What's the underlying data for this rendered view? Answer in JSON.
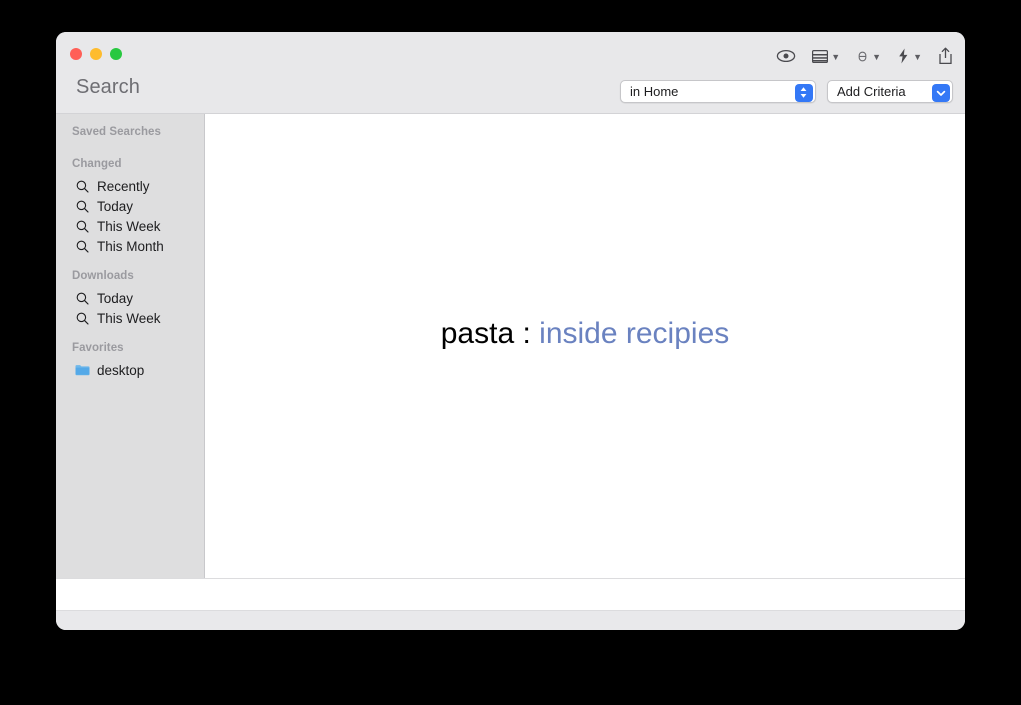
{
  "window": {
    "title": "Search",
    "traffic_lights": [
      {
        "name": "close",
        "color": "#ff5f57"
      },
      {
        "name": "minimize",
        "color": "#febc2e"
      },
      {
        "name": "maximize",
        "color": "#28c840"
      }
    ]
  },
  "toolbar": {
    "items": [
      {
        "icon": "eye-icon",
        "has_chevron": false
      },
      {
        "icon": "list-view-icon",
        "has_chevron": true
      },
      {
        "icon": "group-by-icon",
        "has_chevron": true
      },
      {
        "icon": "action-bolt-icon",
        "has_chevron": true
      },
      {
        "icon": "share-icon",
        "has_chevron": false
      }
    ]
  },
  "criteria": {
    "scope": {
      "label": "in Home",
      "accent": "#3478f6",
      "arrow_glyph": "⇅"
    },
    "add_criteria": {
      "label": "Add Criteria",
      "accent": "#3478f6",
      "arrow_glyph": "⌄"
    }
  },
  "sidebar": {
    "title": "Saved Searches",
    "sections": [
      {
        "header": "Changed",
        "items": [
          {
            "label": "Recently",
            "icon": "search-icon"
          },
          {
            "label": "Today",
            "icon": "search-icon"
          },
          {
            "label": "This Week",
            "icon": "search-icon"
          },
          {
            "label": "This Month",
            "icon": "search-icon"
          }
        ]
      },
      {
        "header": "Downloads",
        "items": [
          {
            "label": "Today",
            "icon": "search-icon"
          },
          {
            "label": "This Week",
            "icon": "search-icon"
          }
        ]
      },
      {
        "header": "Favorites",
        "items": [
          {
            "label": "desktop",
            "icon": "folder-icon"
          }
        ]
      }
    ]
  },
  "content": {
    "query_text": "pasta :",
    "scope_text": "inside recipies",
    "query_color": "#000000",
    "scope_color": "#6a82c0"
  }
}
